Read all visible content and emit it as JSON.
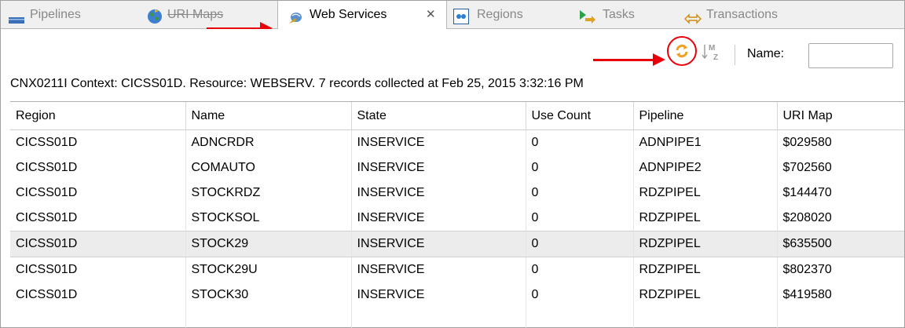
{
  "tabs": [
    {
      "label": "Pipelines",
      "icon": "pipelines-icon",
      "active": false
    },
    {
      "label": "URI Maps",
      "icon": "globe-icon",
      "active": false
    },
    {
      "label": "Web Services",
      "icon": "web-services-icon",
      "active": true,
      "closable": true
    },
    {
      "label": "Regions",
      "icon": "regions-icon",
      "active": false
    },
    {
      "label": "Tasks",
      "icon": "tasks-icon",
      "active": false
    },
    {
      "label": "Transactions",
      "icon": "transactions-icon",
      "active": false
    }
  ],
  "toolbar": {
    "refresh_icon": "refresh-icon",
    "sort_icon": "sort-icon",
    "filter_label": "Name:",
    "filter_value": "",
    "filter_placeholder": ""
  },
  "status": {
    "message": "CNX0211I Context: CICSS01D. Resource: WEBSERV. 7  records collected at Feb 25, 2015 3:32:16 PM"
  },
  "table": {
    "columns": [
      "Region",
      "Name",
      "State",
      "Use Count",
      "Pipeline",
      "URI Map"
    ],
    "rows": [
      [
        "CICSS01D",
        "ADNCRDR",
        "INSERVICE",
        "0",
        "ADNPIPE1",
        "$029580"
      ],
      [
        "CICSS01D",
        "COMAUTO",
        "INSERVICE",
        "0",
        "ADNPIPE2",
        "$702560"
      ],
      [
        "CICSS01D",
        "STOCKRDZ",
        "INSERVICE",
        "0",
        "RDZPIPEL",
        "$144470"
      ],
      [
        "CICSS01D",
        "STOCKSOL",
        "INSERVICE",
        "0",
        "RDZPIPEL",
        "$208020"
      ],
      [
        "CICSS01D",
        "STOCK29",
        "INSERVICE",
        "0",
        "RDZPIPEL",
        "$635500"
      ],
      [
        "CICSS01D",
        "STOCK29U",
        "INSERVICE",
        "0",
        "RDZPIPEL",
        "$802370"
      ],
      [
        "CICSS01D",
        "STOCK30",
        "INSERVICE",
        "0",
        "RDZPIPEL",
        "$419580"
      ]
    ],
    "selected_row": 4
  },
  "colors": {
    "annotation_red": "#e8000b",
    "refresh_orange": "#f0a020",
    "selected_row": "#ececec"
  }
}
